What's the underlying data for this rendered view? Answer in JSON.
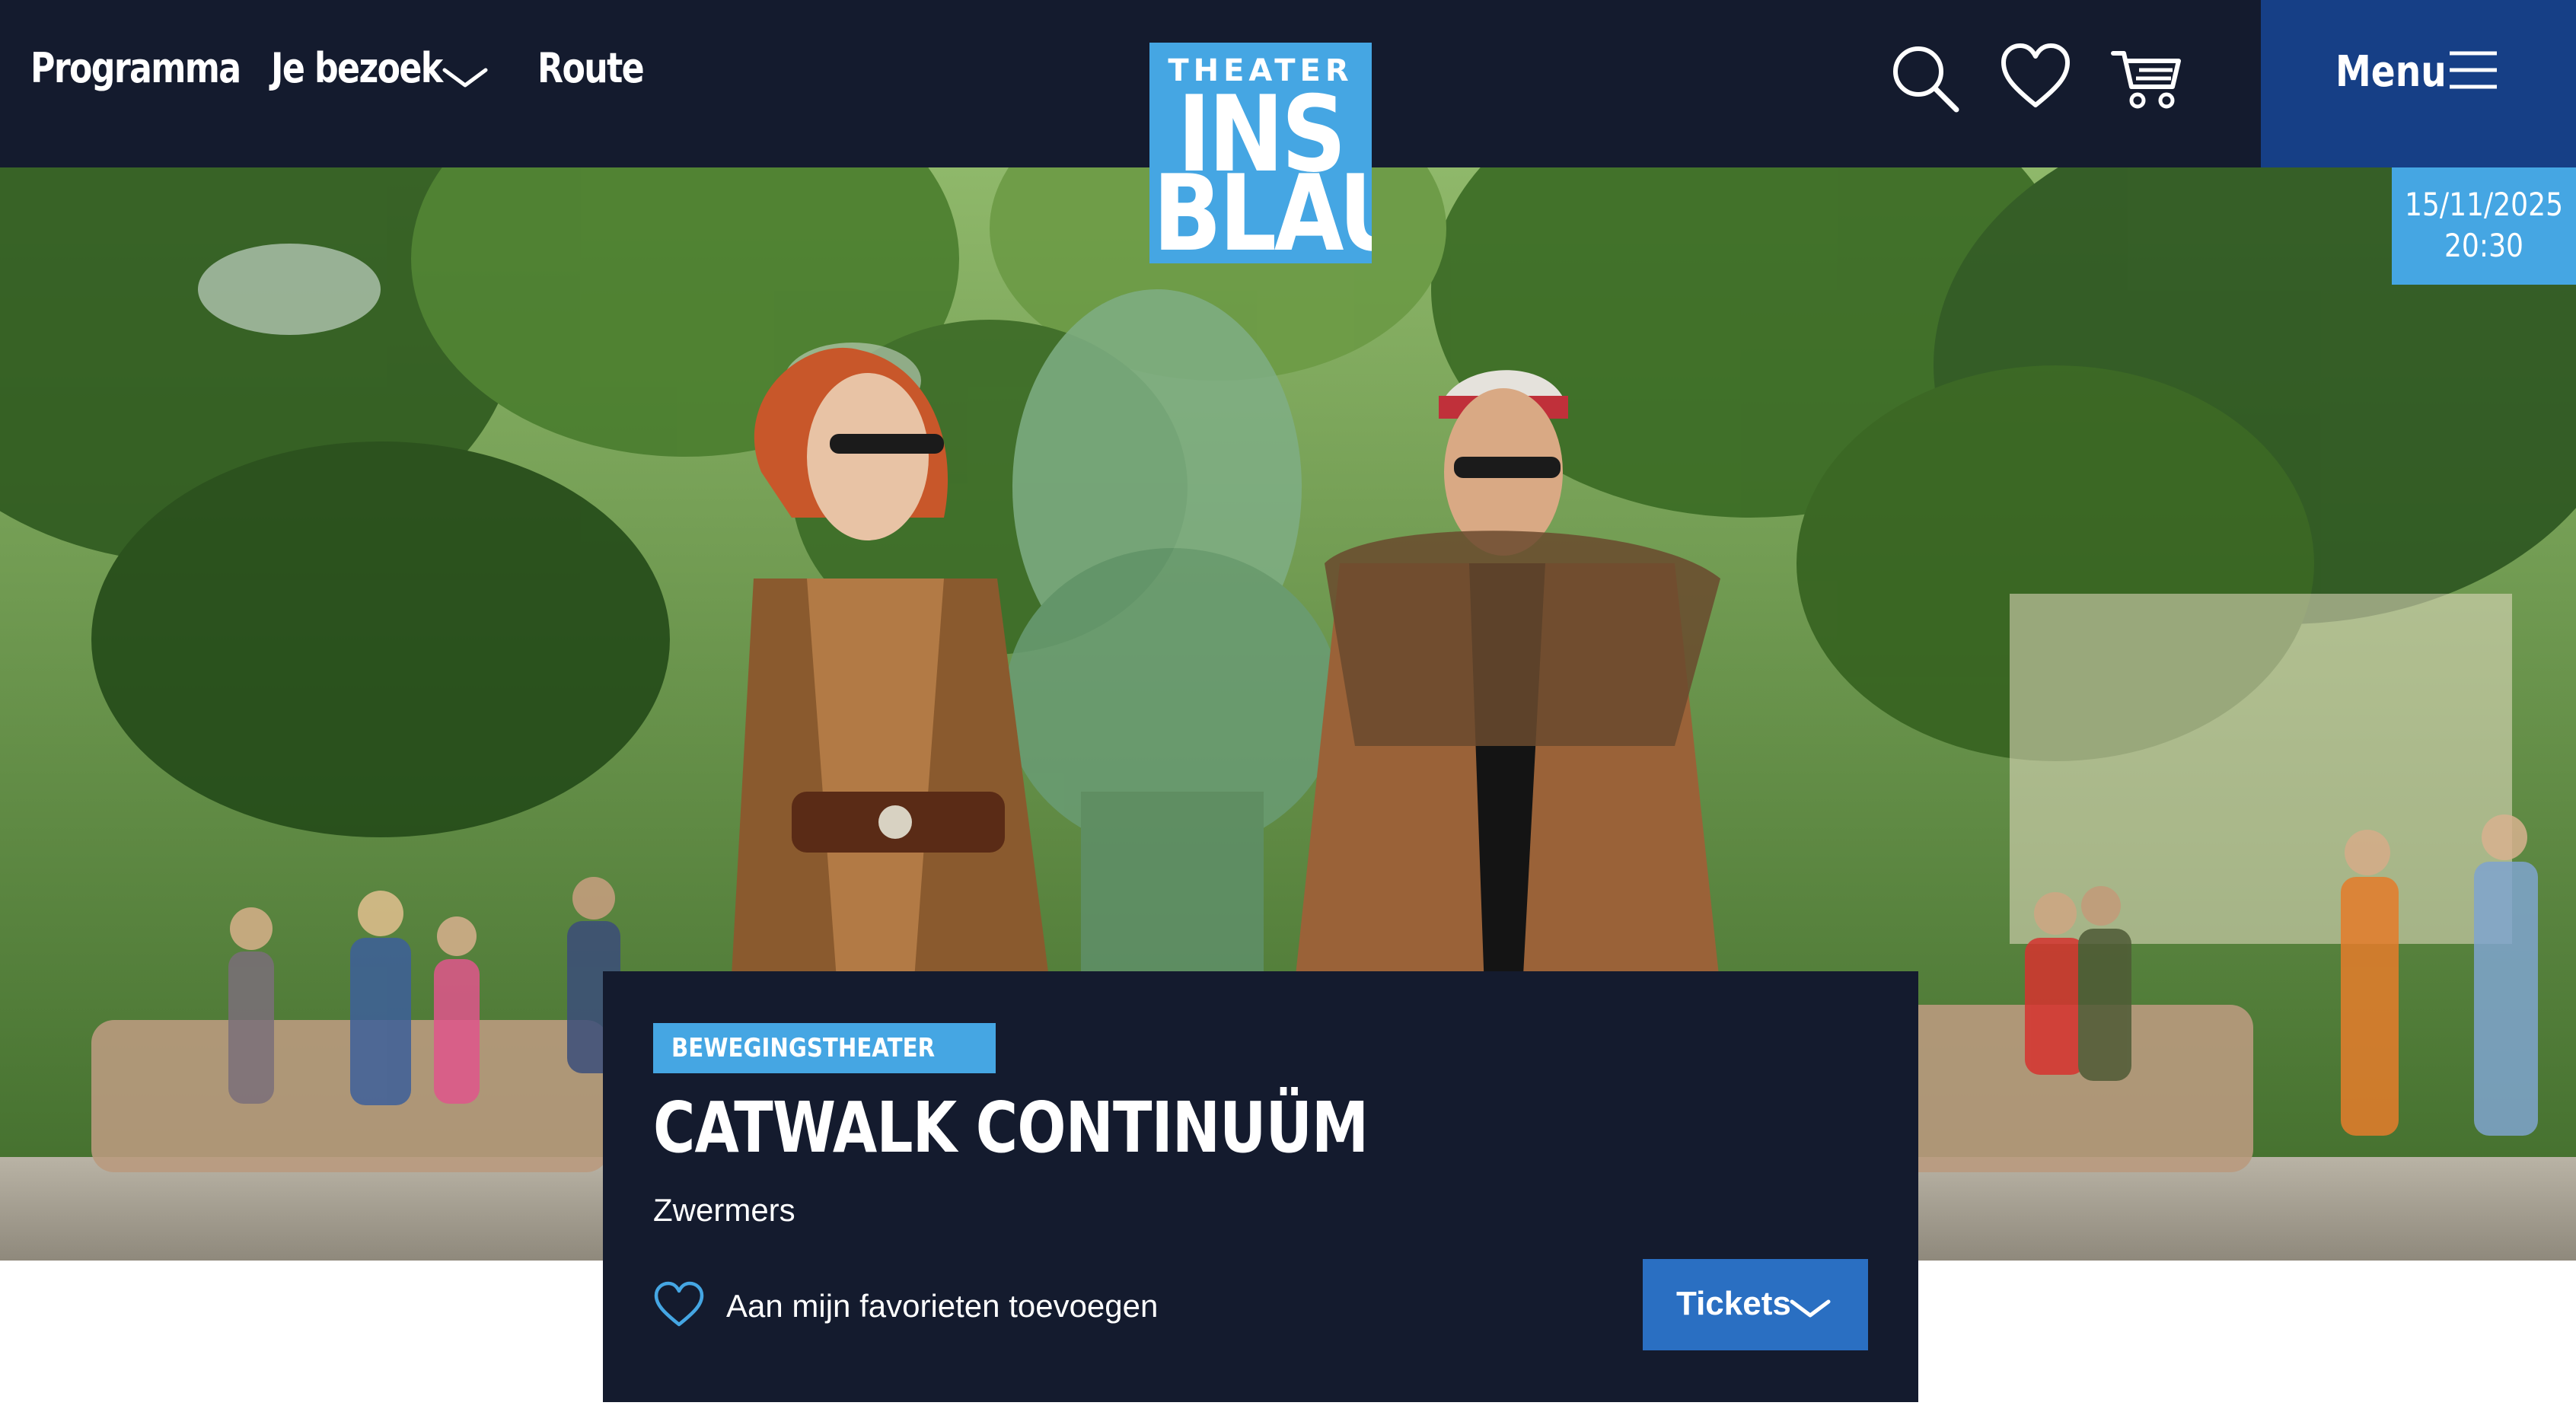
{
  "header": {
    "nav": [
      {
        "label": "Programma",
        "icon": "none"
      },
      {
        "label": "Je bezoek",
        "icon": "chevron-down-icon"
      },
      {
        "label": "Route",
        "icon": "none"
      }
    ],
    "logo": {
      "line1": "THEATER",
      "line2": "INS",
      "line3": "BLAU",
      "color": "#45a6e3"
    },
    "icons": [
      "search-icon",
      "heart-icon",
      "cart-icon"
    ],
    "menu_label": "Menu",
    "background": "#141b2e",
    "menu_background": "#163f86"
  },
  "event": {
    "date": "15/11/2025",
    "time": "20:30",
    "category": "BEWEGINGSTHEATER",
    "title": "CATWALK CONTINUÜM",
    "company": "Zwermers",
    "favorite_label": "Aan mijn favorieten toevoegen",
    "tickets_label": "Tickets"
  },
  "colors": {
    "accent_light_blue": "#45a6e3",
    "button_blue": "#2a6fc2",
    "dark_navy": "#141b2e"
  }
}
